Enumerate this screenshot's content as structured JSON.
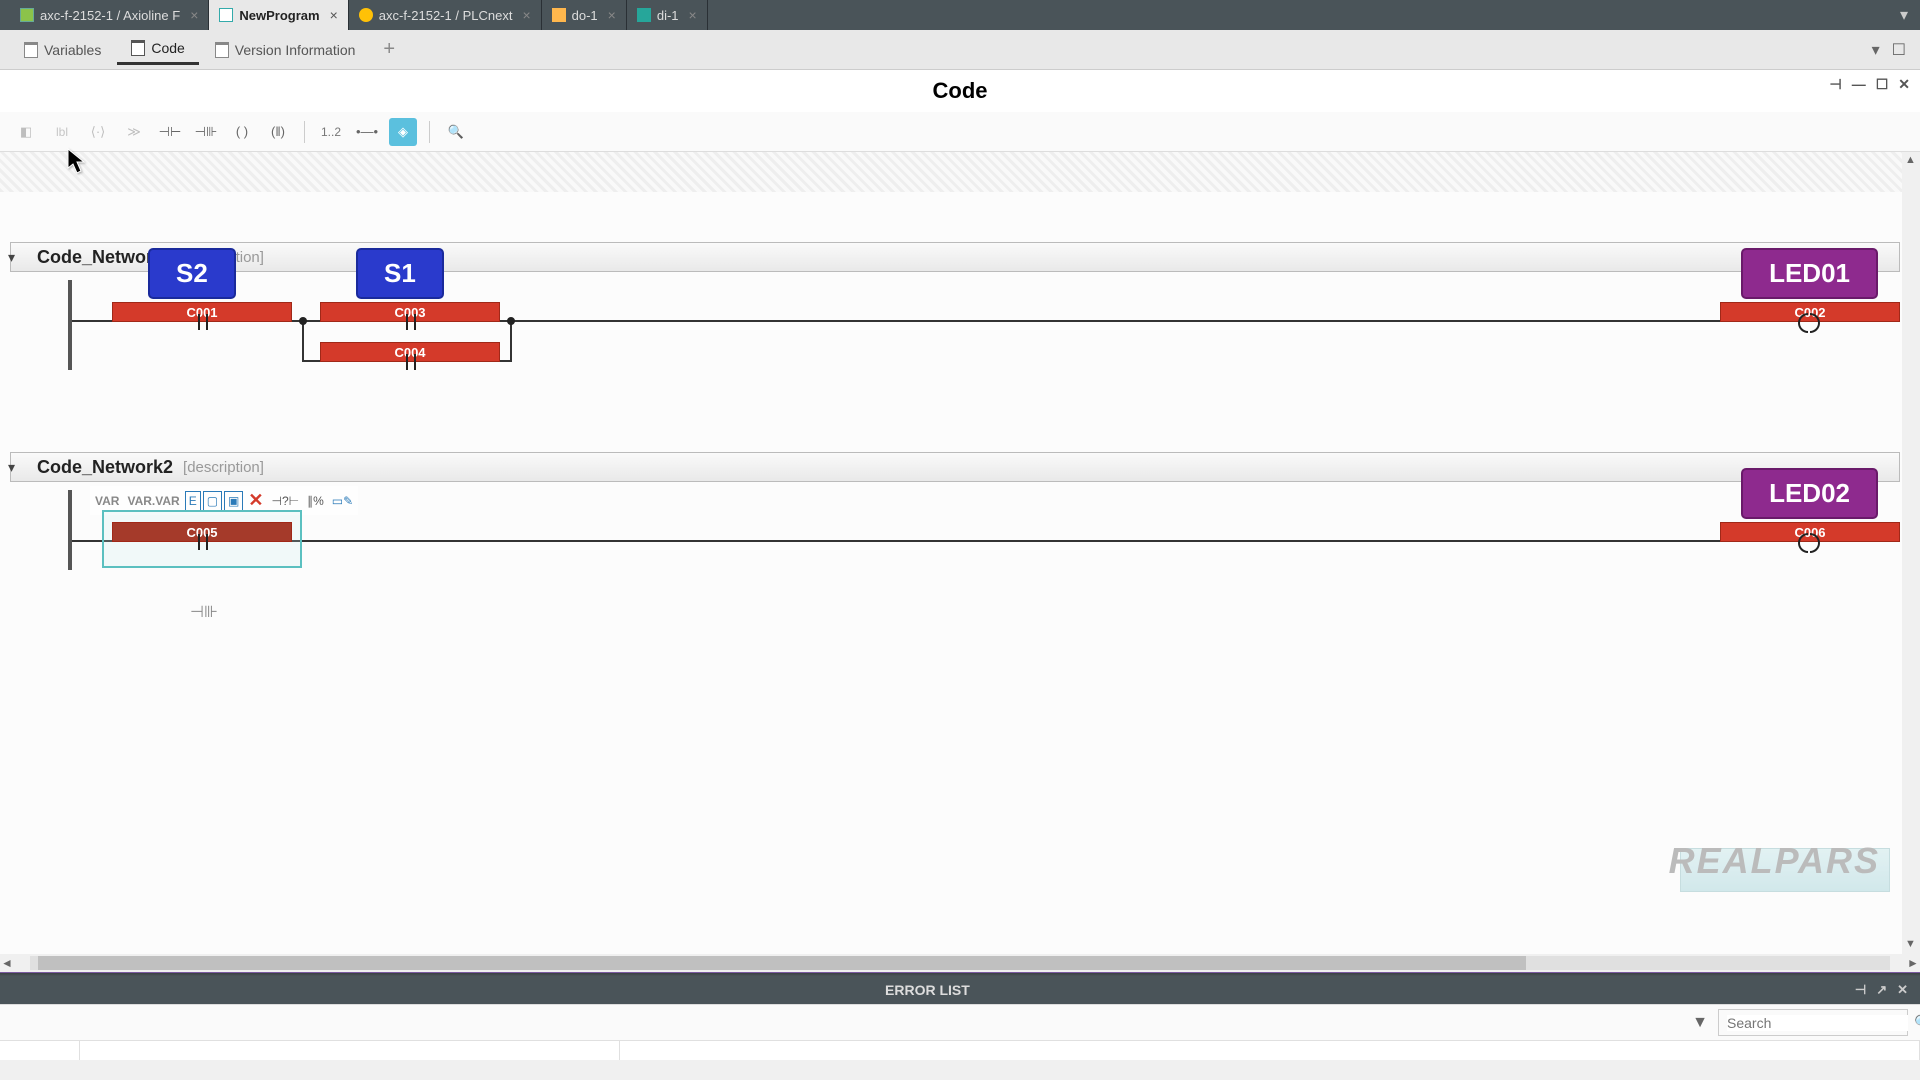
{
  "topTabs": [
    {
      "label": "axc-f-2152-1 / Axioline F",
      "icon": "green"
    },
    {
      "label": "NewProgram",
      "icon": "blue",
      "active": true
    },
    {
      "label": "axc-f-2152-1 / PLCnext",
      "icon": "yellow"
    },
    {
      "label": "do-1",
      "icon": "orange"
    },
    {
      "label": "di-1",
      "icon": "teal"
    }
  ],
  "subTabs": [
    {
      "label": "Variables"
    },
    {
      "label": "Code",
      "active": true
    },
    {
      "label": "Version Information"
    }
  ],
  "header": {
    "title": "Code"
  },
  "toolbar": {
    "zoom": "1..2"
  },
  "networks": {
    "n1": {
      "title": "Code_Network1",
      "desc": "[description]",
      "vars": {
        "s2": "S2",
        "s1": "S1",
        "led": "LED01"
      },
      "contacts": {
        "c001": "C001",
        "c002": "C002",
        "c003": "C003",
        "c004": "C004"
      }
    },
    "n2": {
      "title": "Code_Network2",
      "desc": "[description]",
      "vars": {
        "led": "LED02"
      },
      "contacts": {
        "c005": "C005",
        "c006": "C006"
      },
      "ctx": {
        "var": "VAR",
        "varvar": "VAR.VAR",
        "e": "E"
      }
    }
  },
  "watermark": "REALPARS",
  "errorList": {
    "title": "ERROR LIST",
    "searchPlaceholder": "Search"
  }
}
